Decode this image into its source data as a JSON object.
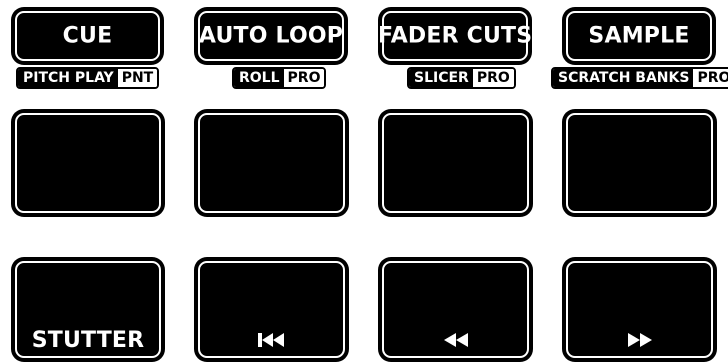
{
  "mode_buttons": [
    {
      "label": "CUE",
      "sub_main": "PITCH PLAY",
      "sub_tag": "PNT"
    },
    {
      "label": "AUTO LOOP",
      "sub_main": "ROLL",
      "sub_tag": "PRO"
    },
    {
      "label": "FADER CUTS",
      "sub_main": "SLICER",
      "sub_tag": "PRO"
    },
    {
      "label": "SAMPLE",
      "sub_main": "SCRATCH BANKS",
      "sub_tag": "PRO"
    }
  ],
  "bottom_pads": [
    {
      "label": "STUTTER"
    },
    {
      "icon": "skip-to-start-icon"
    },
    {
      "icon": "rewind-icon"
    },
    {
      "icon": "fast-forward-icon"
    }
  ]
}
